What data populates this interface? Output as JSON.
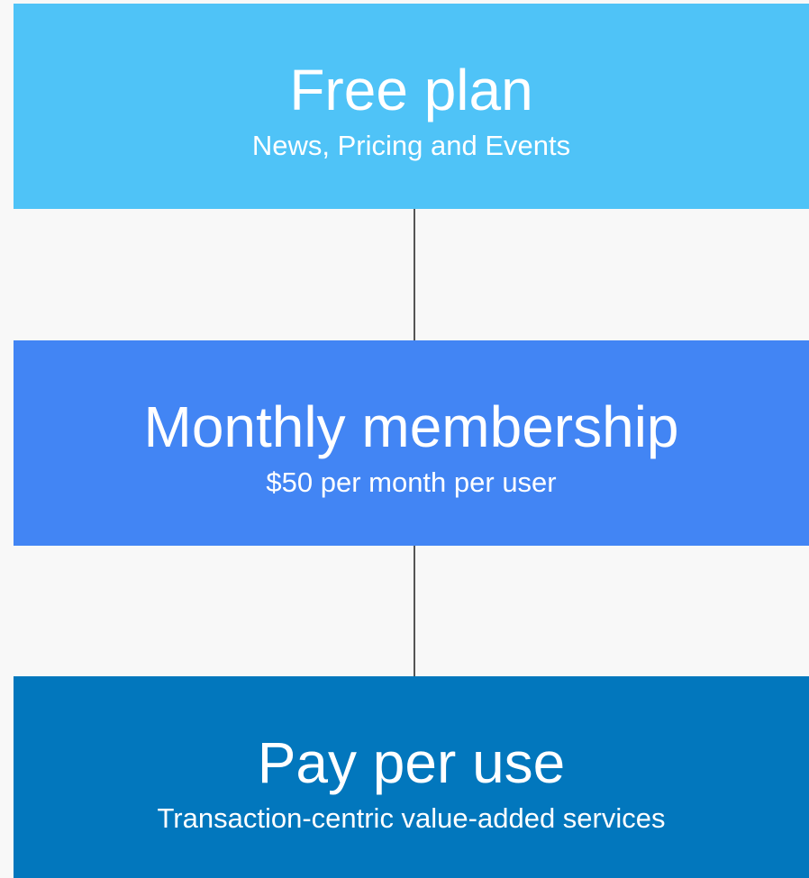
{
  "plans": [
    {
      "title": "Free plan",
      "subtitle": "News, Pricing and Events",
      "color": "#4fc3f7"
    },
    {
      "title": "Monthly membership",
      "subtitle": "$50 per month per user",
      "color": "#4285f4"
    },
    {
      "title": "Pay per use",
      "subtitle": "Transaction-centric value-added services",
      "color": "#0277bd"
    }
  ],
  "connector_color": "#555555",
  "background_color": "#f8f8f8"
}
